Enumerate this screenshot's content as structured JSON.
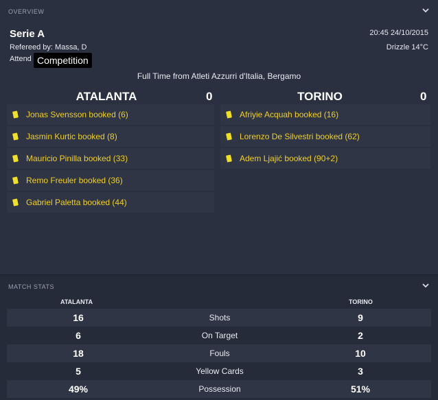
{
  "overview": {
    "section_title": "OVERVIEW",
    "competition": "Serie A",
    "referee": "Refereed by: Massa, D",
    "attendance_partial": "Attend",
    "tooltip": "Competition",
    "datetime": "20:45 24/10/2015",
    "weather": "Drizzle 14°C",
    "venue": "Full Time from Atleti Azzurri d'Italia, Bergamo",
    "home": {
      "name": "ATALANTA",
      "score": "0",
      "events": [
        {
          "text": "Jonas Svensson booked (6)",
          "icon": "yellow-card-icon"
        },
        {
          "text": "Jasmin Kurtic booked (8)",
          "icon": "yellow-card-icon"
        },
        {
          "text": "Mauricio Pinilla booked (33)",
          "icon": "yellow-card-icon"
        },
        {
          "text": "Remo Freuler booked (36)",
          "icon": "yellow-card-icon"
        },
        {
          "text": "Gabriel Paletta booked (44)",
          "icon": "yellow-card-icon"
        }
      ]
    },
    "away": {
      "name": "TORINO",
      "score": "0",
      "events": [
        {
          "text": "Afriyie Acquah booked (16)",
          "icon": "yellow-card-icon"
        },
        {
          "text": "Lorenzo De Silvestri booked (62)",
          "icon": "yellow-card-icon"
        },
        {
          "text": "Adem Ljajić booked (90+2)",
          "icon": "yellow-card-icon"
        }
      ]
    }
  },
  "stats": {
    "section_title": "MATCH STATS",
    "home_label": "ATALANTA",
    "away_label": "TORINO",
    "rows": [
      {
        "home": "16",
        "label": "Shots",
        "away": "9"
      },
      {
        "home": "6",
        "label": "On Target",
        "away": "2"
      },
      {
        "home": "18",
        "label": "Fouls",
        "away": "10"
      },
      {
        "home": "5",
        "label": "Yellow Cards",
        "away": "3"
      },
      {
        "home": "49%",
        "label": "Possession",
        "away": "51%"
      }
    ]
  },
  "colors": {
    "background": "#262b3a",
    "panel": "#2a3040",
    "row": "#2f3545",
    "event_text": "#f0d020",
    "yellow_card": "#f0e020"
  }
}
